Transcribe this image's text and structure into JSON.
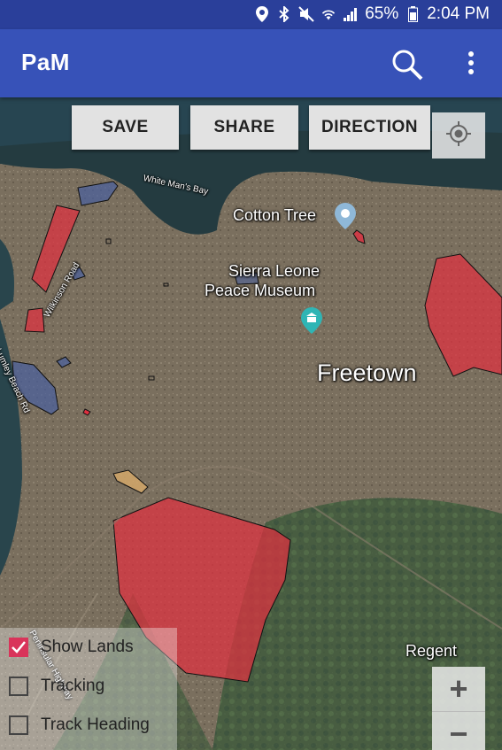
{
  "status_bar": {
    "battery": "65%",
    "time": "2:04 PM"
  },
  "app_bar": {
    "title": "PaM"
  },
  "map_buttons": {
    "save": "SAVE",
    "share": "SHARE",
    "direction": "DIRECTION"
  },
  "map_labels": {
    "white_mans_bay": "White Man's Bay",
    "cotton_tree": "Cotton Tree",
    "museum_line1": "Sierra Leone",
    "museum_line2": "Peace Museum",
    "freetown": "Freetown",
    "regent": "Regent",
    "wilkinson_road": "Wilkinson Road",
    "lumley_beach_rd": "Lumley Beach Rd",
    "peninsular_highway": "Peninsular Highway"
  },
  "options": [
    {
      "label": "Show Lands",
      "checked": true
    },
    {
      "label": "Tracking",
      "checked": false
    },
    {
      "label": "Track Heading",
      "checked": false
    }
  ],
  "zoom": {
    "in": "+",
    "out": "−"
  },
  "colors": {
    "app_bar": "#3752b8",
    "status_bar": "#2a3f9a",
    "land_fill": "#e03040",
    "checkbox_accent": "#d9345a"
  }
}
